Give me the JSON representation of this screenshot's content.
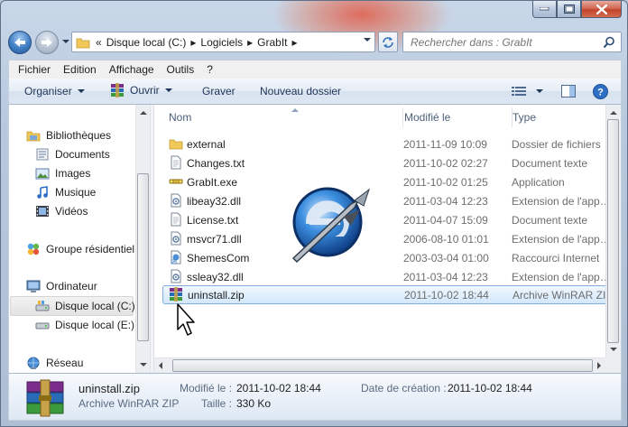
{
  "window": {
    "caption_buttons": [
      "minimize",
      "maximize",
      "close"
    ]
  },
  "nav": {
    "breadcrumb_prefix": "«",
    "breadcrumbs": [
      "Disque local (C:)",
      "Logiciels",
      "GrabIt"
    ],
    "search_placeholder": "Rechercher dans : GrabIt"
  },
  "menu": {
    "items": [
      "Fichier",
      "Edition",
      "Affichage",
      "Outils",
      "?"
    ]
  },
  "toolbar": {
    "organize_label": "Organiser",
    "open_label": "Ouvrir",
    "burn_label": "Graver",
    "new_folder_label": "Nouveau dossier"
  },
  "navpane": {
    "items": [
      {
        "label": "Bibliothèques",
        "icon": "libraries-icon"
      },
      {
        "label": "Documents",
        "icon": "documents-icon"
      },
      {
        "label": "Images",
        "icon": "images-icon"
      },
      {
        "label": "Musique",
        "icon": "music-icon"
      },
      {
        "label": "Vidéos",
        "icon": "videos-icon"
      },
      {
        "label": "Groupe résidentiel",
        "icon": "homegroup-icon"
      },
      {
        "label": "Ordinateur",
        "icon": "computer-icon"
      },
      {
        "label": "Disque local (C:)",
        "icon": "drive-c-icon",
        "selected": true
      },
      {
        "label": "Disque local (E:)",
        "icon": "drive-e-icon"
      },
      {
        "label": "Réseau",
        "icon": "network-icon"
      }
    ]
  },
  "files": {
    "columns": [
      "Nom",
      "Modifié le",
      "Type"
    ],
    "rows": [
      {
        "name": "external",
        "modified": "2011-11-09 10:09",
        "type": "Dossier de fichiers",
        "icon": "folder-icon"
      },
      {
        "name": "Changes.txt",
        "modified": "2011-10-02 02:27",
        "type": "Document texte",
        "icon": "text-file-icon"
      },
      {
        "name": "GrabIt.exe",
        "modified": "2011-10-02 01:25",
        "type": "Application",
        "icon": "application-icon"
      },
      {
        "name": "libeay32.dll",
        "modified": "2011-03-04 12:23",
        "type": "Extension de l'app…",
        "icon": "dll-icon"
      },
      {
        "name": "License.txt",
        "modified": "2011-04-07 15:09",
        "type": "Document texte",
        "icon": "text-file-icon"
      },
      {
        "name": "msvcr71.dll",
        "modified": "2006-08-10 01:01",
        "type": "Extension de l'app…",
        "icon": "dll-icon"
      },
      {
        "name": "ShemesCom",
        "modified": "2003-03-04 01:00",
        "type": "Raccourci Internet",
        "icon": "internet-shortcut-icon"
      },
      {
        "name": "ssleay32.dll",
        "modified": "2011-03-04 12:23",
        "type": "Extension de l'app…",
        "icon": "dll-icon"
      },
      {
        "name": "uninstall.zip",
        "modified": "2011-10-02 18:44",
        "type": "Archive WinRAR ZIP",
        "icon": "winrar-archive-icon",
        "selected": true
      }
    ]
  },
  "details": {
    "filename": "uninstall.zip",
    "filetype": "Archive WinRAR ZIP",
    "modified_label": "Modifié le :",
    "modified_value": "2011-10-02 18:44",
    "created_label": "Date de création :",
    "created_value": "2011-10-02 18:44",
    "size_label": "Taille :",
    "size_value": "330 Ko"
  },
  "colors": {
    "selection_border": "#84acdd",
    "accent_blue": "#1e3457"
  }
}
